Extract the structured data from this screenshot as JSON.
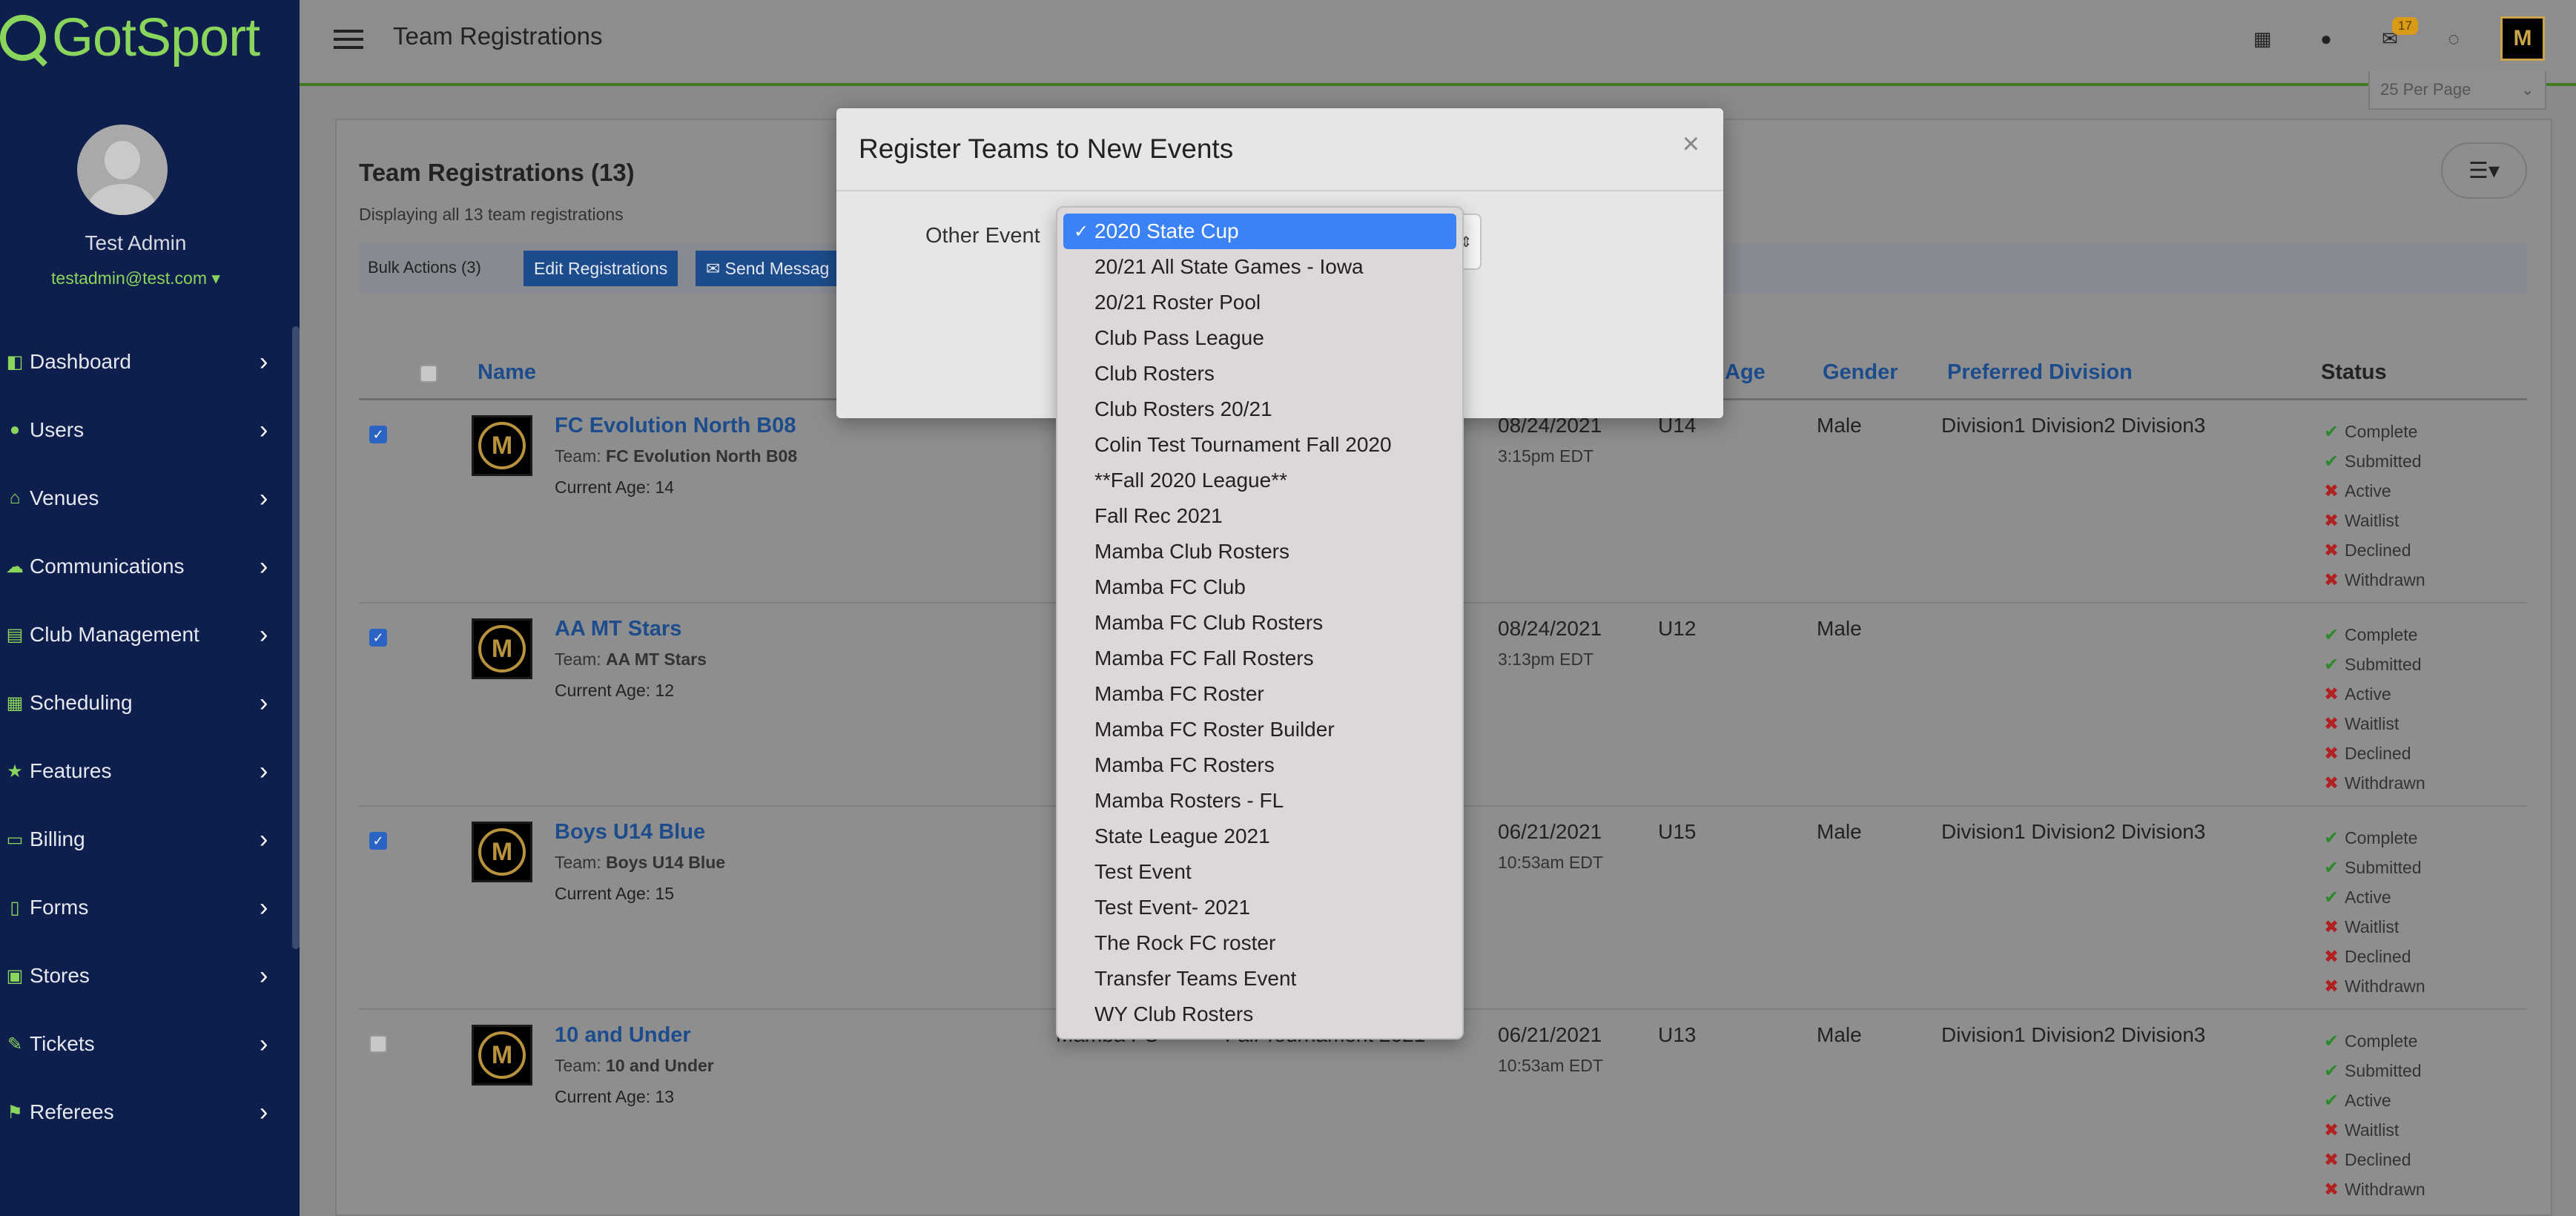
{
  "sidebar": {
    "logo_text": "GotSport",
    "user_name": "Test Admin",
    "user_email": "testadmin@test.com",
    "items": [
      {
        "label": "Dashboard",
        "icon": "dashboard-icon"
      },
      {
        "label": "Users",
        "icon": "users-icon"
      },
      {
        "label": "Venues",
        "icon": "venues-icon"
      },
      {
        "label": "Communications",
        "icon": "communications-icon"
      },
      {
        "label": "Club Management",
        "icon": "club-management-icon"
      },
      {
        "label": "Scheduling",
        "icon": "scheduling-icon"
      },
      {
        "label": "Features",
        "icon": "star-icon"
      },
      {
        "label": "Billing",
        "icon": "billing-icon"
      },
      {
        "label": "Forms",
        "icon": "forms-icon"
      },
      {
        "label": "Stores",
        "icon": "stores-icon"
      },
      {
        "label": "Tickets",
        "icon": "tickets-icon"
      },
      {
        "label": "Referees",
        "icon": "referees-icon"
      }
    ]
  },
  "header": {
    "title": "Team Registrations",
    "mail_count": "17"
  },
  "panel": {
    "title": "Team Registrations (13)",
    "subtitle": "Displaying all 13 team registrations",
    "per_page": "25 Per Page",
    "bulk_label": "Bulk Actions (3)",
    "edit_label": "Edit Registrations",
    "send_label": "Send Messag"
  },
  "table": {
    "columns": {
      "name": "Name",
      "age": "Age",
      "gender": "Gender",
      "division": "Preferred Division",
      "status": "Status"
    },
    "rows": [
      {
        "checked": true,
        "name": "FC Evolution North B08",
        "team_label": "Team:",
        "team": "FC Evolution North B08",
        "current_age": "Current Age: 14",
        "club": "",
        "event": "",
        "date": "08/24/2021",
        "time": "3:15pm EDT",
        "age": "U14",
        "gender": "Male",
        "division": "Division1 Division2 Division3",
        "status": [
          {
            "mark": "✔",
            "label": "Complete",
            "ok": true
          },
          {
            "mark": "✔",
            "label": "Submitted",
            "ok": true
          },
          {
            "mark": "✖",
            "label": "Active",
            "ok": false
          },
          {
            "mark": "✖",
            "label": "Waitlist",
            "ok": false
          },
          {
            "mark": "✖",
            "label": "Declined",
            "ok": false
          },
          {
            "mark": "✖",
            "label": "Withdrawn",
            "ok": false
          }
        ]
      },
      {
        "checked": true,
        "name": "AA MT Stars",
        "team_label": "Team:",
        "team": "AA MT Stars",
        "current_age": "Current Age: 12",
        "club": "",
        "event": "",
        "date": "08/24/2021",
        "time": "3:13pm EDT",
        "age": "U12",
        "gender": "Male",
        "division": "",
        "status": [
          {
            "mark": "✔",
            "label": "Complete",
            "ok": true
          },
          {
            "mark": "✔",
            "label": "Submitted",
            "ok": true
          },
          {
            "mark": "✖",
            "label": "Active",
            "ok": false
          },
          {
            "mark": "✖",
            "label": "Waitlist",
            "ok": false
          },
          {
            "mark": "✖",
            "label": "Declined",
            "ok": false
          },
          {
            "mark": "✖",
            "label": "Withdrawn",
            "ok": false
          }
        ]
      },
      {
        "checked": true,
        "name": "Boys U14 Blue",
        "team_label": "Team:",
        "team": "Boys U14 Blue",
        "current_age": "Current Age: 15",
        "club": "",
        "event": "",
        "date": "06/21/2021",
        "time": "10:53am EDT",
        "age": "U15",
        "gender": "Male",
        "division": "Division1 Division2 Division3",
        "status": [
          {
            "mark": "✔",
            "label": "Complete",
            "ok": true
          },
          {
            "mark": "✔",
            "label": "Submitted",
            "ok": true
          },
          {
            "mark": "✔",
            "label": "Active",
            "ok": true
          },
          {
            "mark": "✖",
            "label": "Waitlist",
            "ok": false
          },
          {
            "mark": "✖",
            "label": "Declined",
            "ok": false
          },
          {
            "mark": "✖",
            "label": "Withdrawn",
            "ok": false
          }
        ]
      },
      {
        "checked": false,
        "name": "10 and Under",
        "team_label": "Team:",
        "team": "10 and Under",
        "current_age": "Current Age: 13",
        "club": "Mamba FC",
        "event": "Fall Tournament 2021",
        "date": "06/21/2021",
        "time": "10:53am EDT",
        "age": "U13",
        "gender": "Male",
        "division": "Division1 Division2 Division3",
        "status": [
          {
            "mark": "✔",
            "label": "Complete",
            "ok": true
          },
          {
            "mark": "✔",
            "label": "Submitted",
            "ok": true
          },
          {
            "mark": "✔",
            "label": "Active",
            "ok": true
          },
          {
            "mark": "✖",
            "label": "Waitlist",
            "ok": false
          },
          {
            "mark": "✖",
            "label": "Declined",
            "ok": false
          },
          {
            "mark": "✖",
            "label": "Withdrawn",
            "ok": false
          }
        ]
      }
    ]
  },
  "modal": {
    "title": "Register Teams to New Events",
    "close": "×",
    "other_event_label": "Other Event",
    "selected": "2020 State Cup",
    "options": [
      "2020 State Cup",
      "20/21 All State Games - Iowa",
      "20/21 Roster Pool",
      "Club Pass League",
      "Club Rosters",
      "Club Rosters 20/21",
      "Colin Test Tournament Fall 2020",
      "**Fall 2020 League**",
      "Fall Rec 2021",
      "Mamba Club Rosters",
      "Mamba FC Club",
      "Mamba FC Club Rosters",
      "Mamba FC Fall Rosters",
      "Mamba FC Roster",
      "Mamba FC Roster Builder",
      "Mamba FC Rosters",
      "Mamba Rosters - FL",
      "State League 2021",
      "Test Event",
      "Test Event- 2021",
      "The Rock FC roster",
      "Transfer Teams Event",
      "WY Club Rosters"
    ]
  }
}
